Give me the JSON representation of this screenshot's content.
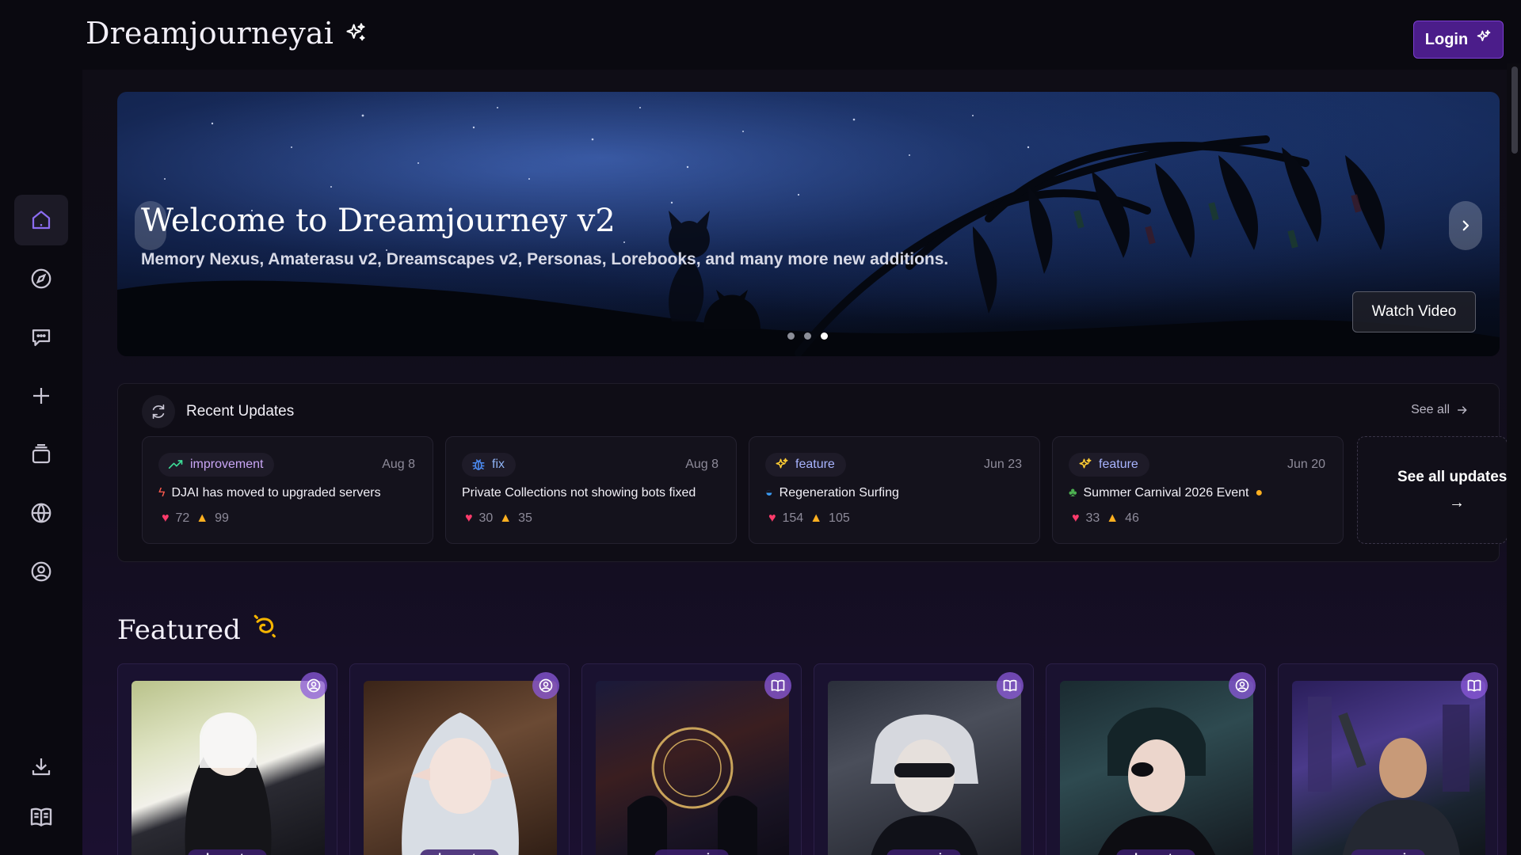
{
  "app": {
    "brand": "Dreamjourneyai",
    "login_label": "Login"
  },
  "sidebar": {
    "items": [
      {
        "icon": "home-icon",
        "active": true
      },
      {
        "icon": "compass-icon",
        "active": false
      },
      {
        "icon": "chat-icon",
        "active": false
      },
      {
        "icon": "plus-icon",
        "active": false
      },
      {
        "icon": "collection-icon",
        "active": false
      },
      {
        "icon": "globe-icon",
        "active": false
      },
      {
        "icon": "user-icon",
        "active": false
      },
      {
        "icon": "download-icon",
        "active": false
      },
      {
        "icon": "book-icon",
        "active": false
      }
    ]
  },
  "hero": {
    "title": "Welcome to Dreamjourney v2",
    "subtitle": "Memory Nexus, Amaterasu v2, Dreamscapes v2, Personas, Lorebooks, and many more new additions.",
    "watch_label": "Watch Video",
    "slides": 3,
    "active_slide": 3
  },
  "updates": {
    "title": "Recent Updates",
    "see_all": "See all",
    "see_all_updates": "See all updates",
    "cards": [
      {
        "tag": "improvement",
        "date": "Aug 8",
        "title": "DJAI has moved to upgraded servers",
        "hearts": "72",
        "fires": "99"
      },
      {
        "tag": "fix",
        "date": "Aug 8",
        "title": "Private Collections not showing bots fixed",
        "hearts": "30",
        "fires": "35"
      },
      {
        "tag": "feature",
        "date": "Jun 23",
        "title": "Regeneration Surfing",
        "hearts": "154",
        "fires": "105"
      },
      {
        "tag": "feature",
        "date": "Jun 20",
        "title": "Summer Carnival 2026 Event",
        "hearts": "33",
        "fires": "46"
      }
    ]
  },
  "featured": {
    "title": "Featured",
    "cards": [
      {
        "type": "character",
        "badge": "user-icon"
      },
      {
        "type": "character",
        "badge": "user-icon"
      },
      {
        "type": "scenario",
        "badge": "book-icon"
      },
      {
        "type": "scenario",
        "badge": "book-icon"
      },
      {
        "type": "character",
        "badge": "user-icon"
      },
      {
        "type": "scenario",
        "badge": "book-icon"
      }
    ]
  },
  "colors": {
    "accent": "#4b1d8a",
    "background": "#0d0b14",
    "heart": "#ff3b6b",
    "fire": "#ffb020"
  }
}
